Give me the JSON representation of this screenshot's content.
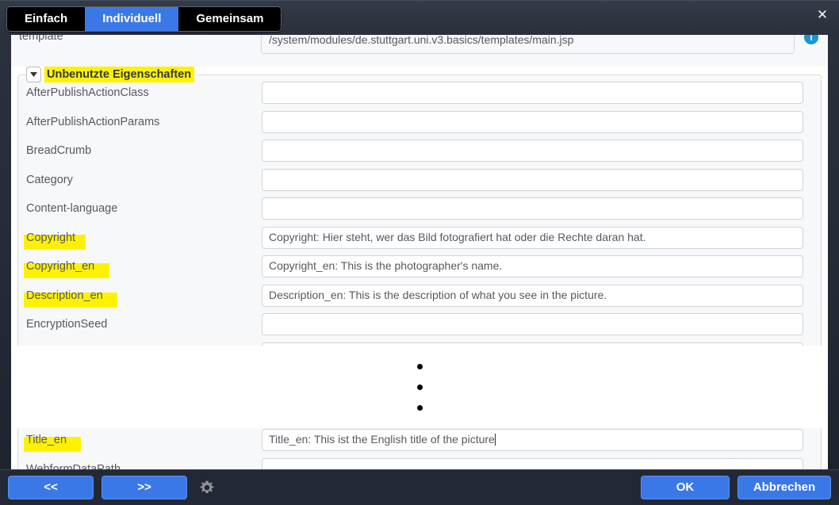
{
  "window": {
    "close_label": "✕"
  },
  "tabs": [
    {
      "label": "Einfach",
      "active": false
    },
    {
      "label": "Individuell",
      "active": true
    },
    {
      "label": "Gemeinsam",
      "active": false
    }
  ],
  "top_row": {
    "label": "template",
    "value": "/system/modules/de.stuttgart.uni.v3.basics/templates/main.jsp",
    "info_icon": "info-icon",
    "info_glyph": "i"
  },
  "fieldset": {
    "legend": "Unbenutzte Eigenschaften",
    "toggle_icon": "chevron-down-icon",
    "expanded": true
  },
  "properties": [
    {
      "label": "AfterPublishActionClass",
      "value": "",
      "highlight": false
    },
    {
      "label": "AfterPublishActionParams",
      "value": "",
      "highlight": false
    },
    {
      "label": "BreadCrumb",
      "value": "",
      "highlight": false
    },
    {
      "label": "Category",
      "value": "",
      "highlight": false
    },
    {
      "label": "Content-language",
      "value": "",
      "highlight": false
    },
    {
      "label": "Copyright",
      "value": "Copyright: Hier steht, wer das Bild fotografiert hat oder die Rechte daran hat.",
      "highlight": true
    },
    {
      "label": "Copyright_en",
      "value": "Copyright_en: This is the photographer's name.",
      "highlight": true
    },
    {
      "label": "Description_en",
      "value": "Description_en: This is the description of what you see in the picture.",
      "highlight": true
    },
    {
      "label": "EncryptionSeed",
      "value": "",
      "highlight": false
    }
  ],
  "properties_after_gap": [
    {
      "label": "Title_en",
      "value": "Title_en: This ist the English title of the picture",
      "highlight": true,
      "caret": true
    },
    {
      "label": "WebformDataPath",
      "value": "",
      "highlight": false,
      "caret": false
    }
  ],
  "gap": {
    "marker": "vertical-ellipsis",
    "dots": 3
  },
  "footer": {
    "prev_label": "<<",
    "next_label": ">>",
    "gear_icon": "gear-icon",
    "ok_label": "OK",
    "cancel_label": "Abbrechen"
  },
  "colors": {
    "accent_blue": "#3b78e7",
    "highlight_yellow": "#fff200",
    "chrome_dark": "#222835",
    "info_blue": "#1796d3"
  }
}
